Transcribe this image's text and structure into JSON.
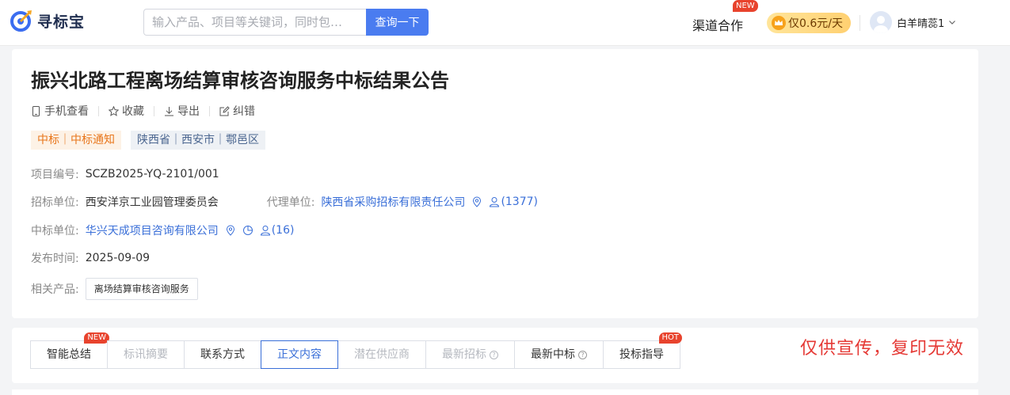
{
  "header": {
    "logo_text": "寻标宝",
    "search_placeholder": "输入产品、项目等关键词，同时包…",
    "search_button": "查询一下",
    "channel_label": "渠道合作",
    "channel_badge": "NEW",
    "vip_label": "仅0.6元/天",
    "user_name": "白羊晴蕊1"
  },
  "notice": {
    "title": "振兴北路工程离场结算审核咨询服务中标结果公告",
    "actions": [
      "手机查看",
      "收藏",
      "导出",
      "纠错"
    ],
    "tags": {
      "type": "中标｜中标通知",
      "region": "陕西省｜西安市｜鄠邑区"
    },
    "project_no_label": "项目编号:",
    "project_no": "SCZB2025-YQ-2101/001",
    "tenderer_label": "招标单位:",
    "tenderer": "西安洋京工业园管理委员会",
    "agency_label": "代理单位:",
    "agency": "陕西省采购招标有限责任公司",
    "agency_count": "(1377)",
    "winner_label": "中标单位:",
    "winner": "华兴天成项目咨询有限公司",
    "winner_count": "(16)",
    "publish_label": "发布时间:",
    "publish_date": "2025-09-09",
    "product_label": "相关产品:",
    "product": "离场结算审核咨询服务"
  },
  "tabs": [
    {
      "label": "智能总结",
      "badge": "NEW"
    },
    {
      "label": "标讯摘要"
    },
    {
      "label": "联系方式"
    },
    {
      "label": "正文内容"
    },
    {
      "label": "潜在供应商"
    },
    {
      "label": "最新招标"
    },
    {
      "label": "最新中标"
    },
    {
      "label": "投标指导",
      "badge": "HOT"
    }
  ],
  "watermark": "仅供宣传，复印无效",
  "colors": {
    "accent": "#3a6fd8",
    "button": "#4a7cf0",
    "badge": "#e8432d",
    "watermark": "#e53935"
  }
}
